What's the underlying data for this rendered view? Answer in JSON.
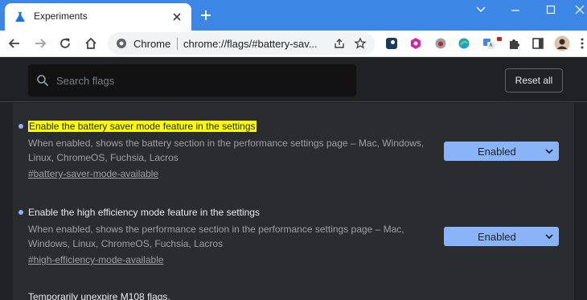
{
  "tab": {
    "title": "Experiments"
  },
  "omnibox": {
    "chrome_label": "Chrome",
    "url": "chrome://flags/#battery-sav..."
  },
  "search": {
    "placeholder": "Search flags"
  },
  "header": {
    "reset_label": "Reset all"
  },
  "flags": [
    {
      "title": "Enable the battery saver mode feature in the settings",
      "highlighted": true,
      "description": "When enabled, shows the battery section in the performance settings page – Mac, Windows, Linux, ChromeOS, Fuchsia, Lacros",
      "link": "#battery-saver-mode-available",
      "state": "Enabled"
    },
    {
      "title": "Enable the high efficiency mode feature in the settings",
      "highlighted": false,
      "description": "When enabled, shows the performance section in the performance settings page – Mac, Windows, Linux, ChromeOS, Fuchsia, Lacros",
      "link": "#high-efficiency-mode-available",
      "state": "Enabled"
    },
    {
      "title": "Temporarily unexpire M108 flags."
    }
  ],
  "colors": {
    "tabstrip": "#3c86e6",
    "page_bg": "#202124",
    "panel_bg": "#2b2c30",
    "accent": "#8ab4f8",
    "highlight": "#ffff00"
  },
  "icons": {
    "favicon": "flask-icon",
    "extensions": [
      "steam-icon",
      "pink-hexagon-icon",
      "bug-icon",
      "edge-icon",
      "translate-icon",
      "red-logo-icon",
      "puzzle-icon",
      "sidepanel-icon",
      "avatar"
    ]
  }
}
